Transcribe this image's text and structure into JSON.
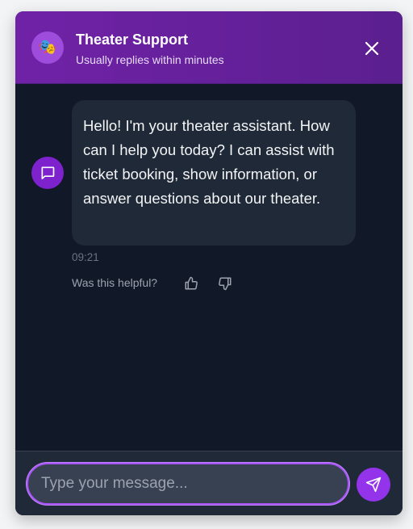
{
  "header": {
    "title": "Theater Support",
    "subtitle": "Usually replies within minutes",
    "avatar_icon": "theater-masks-icon",
    "avatar_glyph": "🎭",
    "close_icon": "close-icon"
  },
  "messages": [
    {
      "sender": "bot",
      "text": "Hello! I'm your theater assistant. How can I help you today? I can assist with ticket booking, show information, or answer questions about our theater.",
      "time": "09:21",
      "avatar_icon": "chat-bubble-icon"
    }
  ],
  "feedback": {
    "prompt": "Was this helpful?",
    "up_icon": "thumbs-up-icon",
    "down_icon": "thumbs-down-icon"
  },
  "composer": {
    "placeholder": "Type your message...",
    "value": "",
    "send_icon": "send-icon"
  },
  "colors": {
    "header_start": "#7022a7",
    "header_end": "#5b1f8f",
    "accent": "#9333ea",
    "background": "#111827",
    "bubble": "#1f2937"
  }
}
